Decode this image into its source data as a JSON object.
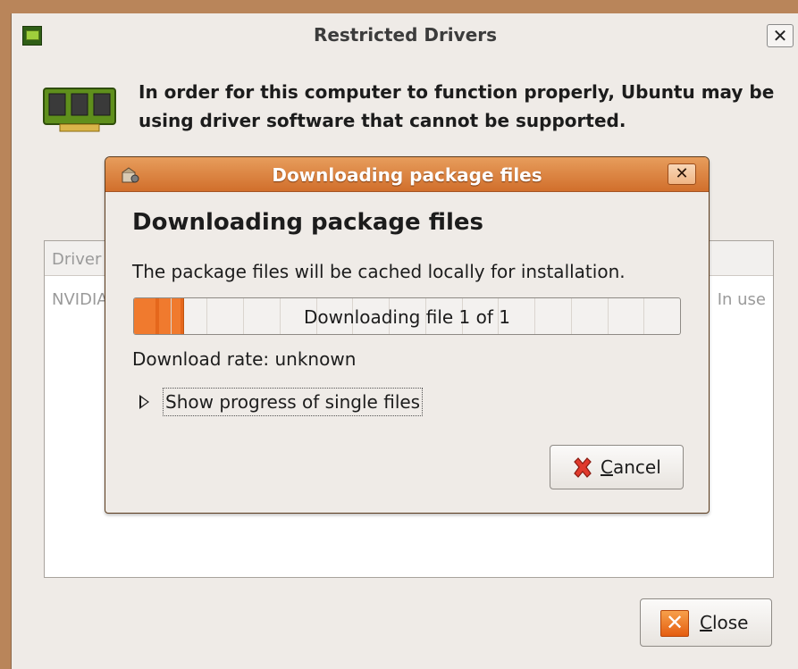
{
  "window": {
    "title": "Restricted Drivers",
    "close_glyph": "✕",
    "app_icon": "chip-icon",
    "header_text": "In order for this computer to function properly, Ubuntu may be using driver software that cannot be supported."
  },
  "drivers_list": {
    "column_driver": "Driver",
    "rows": [
      {
        "name": "NVIDIA",
        "status": "In use"
      }
    ]
  },
  "close_button": {
    "label": "Close",
    "icon": "close-x-icon"
  },
  "dialog": {
    "title": "Downloading package files",
    "close_glyph": "✕",
    "heading": "Downloading package files",
    "description": "The package files will be cached locally for installation.",
    "progress": {
      "text": "Downloading file 1 of 1",
      "fraction": 0.09
    },
    "rate_text": "Download rate: unknown",
    "expander_label": "Show progress of single files",
    "cancel_label": "Cancel"
  }
}
